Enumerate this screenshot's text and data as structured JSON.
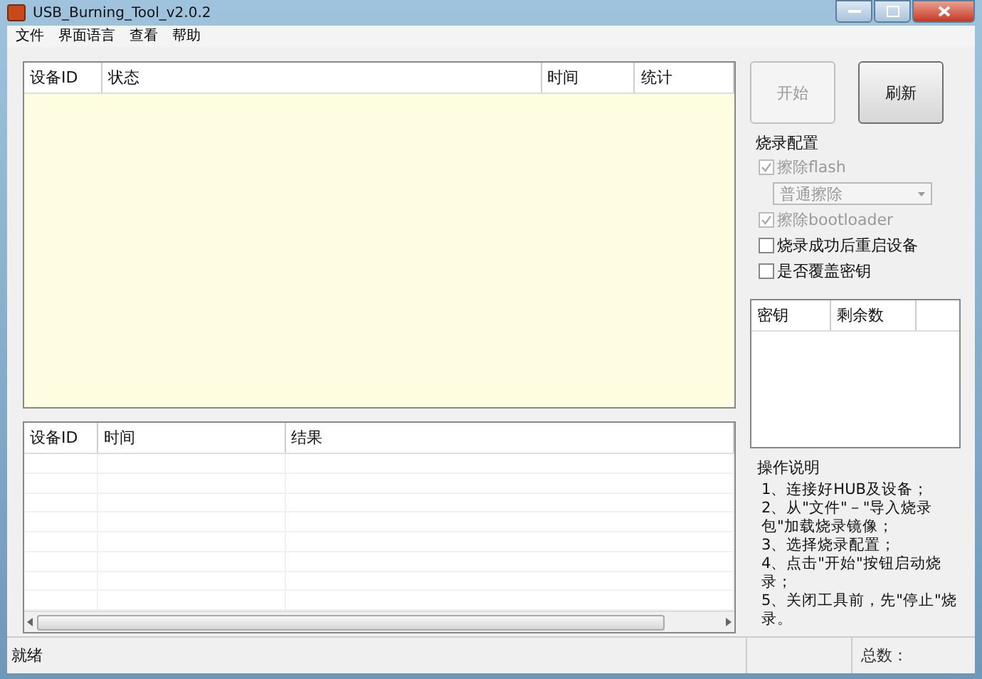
{
  "window": {
    "title": "USB_Burning_Tool_v2.0.2"
  },
  "menu": [
    "文件",
    "界面语言",
    "查看",
    "帮助"
  ],
  "device_table": {
    "columns": [
      "设备ID",
      "状态",
      "时间",
      "统计"
    ]
  },
  "log_table": {
    "columns": [
      "设备ID",
      "时间",
      "结果"
    ]
  },
  "buttons": [
    {
      "label": "开始",
      "disabled": true
    },
    {
      "label": "刷新",
      "disabled": false
    }
  ],
  "burn_config": {
    "title": "烧录配置",
    "options": [
      {
        "kind": "checkbox",
        "label": "擦除flash",
        "checked": true,
        "disabled": true
      },
      {
        "kind": "dropdown",
        "value": "普通擦除",
        "disabled": true
      },
      {
        "kind": "checkbox",
        "label": "擦除bootloader",
        "checked": true,
        "disabled": true
      },
      {
        "kind": "checkbox",
        "label": "烧录成功后重启设备",
        "checked": false,
        "disabled": false
      },
      {
        "kind": "checkbox",
        "label": "是否覆盖密钥",
        "checked": false,
        "disabled": false
      }
    ]
  },
  "key_table": {
    "columns": [
      "密钥",
      "剩余数"
    ]
  },
  "instructions": {
    "title": "操作说明",
    "steps": [
      "1、连接好HUB及设备；",
      "2、从\"文件\"－\"导入烧录包\"加载烧录镜像；",
      "3、选择烧录配置；",
      "4、点击\"开始\"按钮启动烧录；",
      "5、关闭工具前，先\"停止\"烧录。"
    ]
  },
  "status_bar": {
    "status": "就绪",
    "total_label": "总数："
  }
}
